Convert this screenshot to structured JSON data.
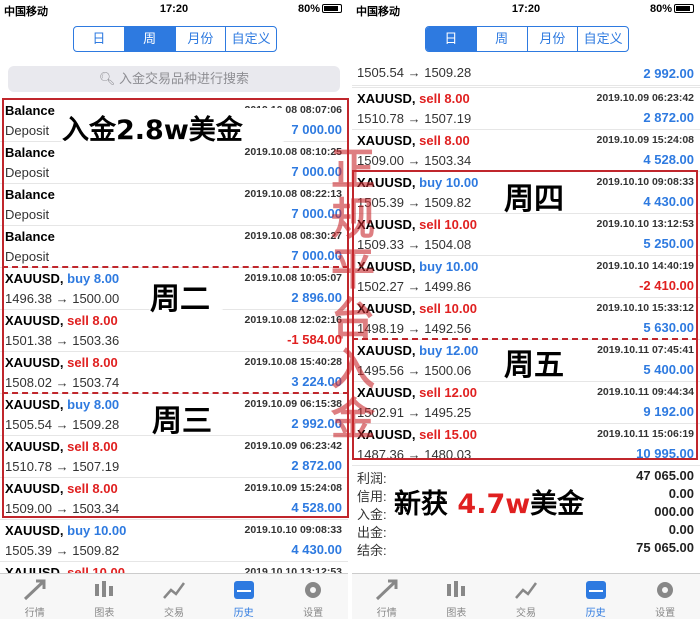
{
  "status": {
    "carrier": "中国移动",
    "time": "17:20",
    "battery": "80%"
  },
  "tabs_periods": [
    "日",
    "周",
    "月份",
    "自定义"
  ],
  "left": {
    "active_period": 1,
    "search_placeholder": "入金交易品种进行搜索",
    "rows": [
      {
        "sym": "Balance",
        "dir": "",
        "sub": "Deposit",
        "ts": "2019.10.08 08:07:06",
        "amt": "7 000.00",
        "color": "blue"
      },
      {
        "sym": "Balance",
        "dir": "",
        "sub": "Deposit",
        "ts": "2019.10.08 08:10:25",
        "amt": "7 000.00",
        "color": "blue"
      },
      {
        "sym": "Balance",
        "dir": "",
        "sub": "Deposit",
        "ts": "2019.10.08 08:22:13",
        "amt": "7 000.00",
        "color": "blue"
      },
      {
        "sym": "Balance",
        "dir": "",
        "sub": "Deposit",
        "ts": "2019.10.08 08:30:27",
        "amt": "7 000.00",
        "color": "blue"
      },
      {
        "sym": "XAUUSD,",
        "dir": "buy 8.00",
        "sub": "1496.38 → 1500.00",
        "ts": "2019.10.08 10:05:07",
        "amt": "2 896.00",
        "color": "blue"
      },
      {
        "sym": "XAUUSD,",
        "dir": "sell 8.00",
        "sub": "1501.38 → 1503.36",
        "ts": "2019.10.08 12:02:16",
        "amt": "-1 584.00",
        "color": "red"
      },
      {
        "sym": "XAUUSD,",
        "dir": "sell 8.00",
        "sub": "1508.02 → 1503.74",
        "ts": "2019.10.08 15:40:28",
        "amt": "3 224.00",
        "color": "blue"
      },
      {
        "sym": "XAUUSD,",
        "dir": "buy 8.00",
        "sub": "1505.54 → 1509.28",
        "ts": "2019.10.09 06:15:38",
        "amt": "2 992.00",
        "color": "blue"
      },
      {
        "sym": "XAUUSD,",
        "dir": "sell 8.00",
        "sub": "1510.78 → 1507.19",
        "ts": "2019.10.09 06:23:42",
        "amt": "2 872.00",
        "color": "blue"
      },
      {
        "sym": "XAUUSD,",
        "dir": "sell 8.00",
        "sub": "1509.00 → 1503.34",
        "ts": "2019.10.09 15:24:08",
        "amt": "4 528.00",
        "color": "blue"
      },
      {
        "sym": "XAUUSD,",
        "dir": "buy 10.00",
        "sub": "1505.39 → 1509.82",
        "ts": "2019.10.10 09:08:33",
        "amt": "4 430.00",
        "color": "blue"
      },
      {
        "sym": "XAUUSD,",
        "dir": "sell 10.00",
        "sub": "",
        "ts": "2019.10.10 13:12:53",
        "amt": "",
        "color": "blue"
      }
    ]
  },
  "right": {
    "active_period": 0,
    "partial": {
      "sub": "1505.54 → 1509.28",
      "amt": "2 992.00"
    },
    "rows": [
      {
        "sym": "XAUUSD,",
        "dir": "sell 8.00",
        "sub": "1510.78 → 1507.19",
        "ts": "2019.10.09 06:23:42",
        "amt": "2 872.00",
        "color": "blue"
      },
      {
        "sym": "XAUUSD,",
        "dir": "sell 8.00",
        "sub": "1509.00 → 1503.34",
        "ts": "2019.10.09 15:24:08",
        "amt": "4 528.00",
        "color": "blue"
      },
      {
        "sym": "XAUUSD,",
        "dir": "buy 10.00",
        "sub": "1505.39 → 1509.82",
        "ts": "2019.10.10 09:08:33",
        "amt": "4 430.00",
        "color": "blue"
      },
      {
        "sym": "XAUUSD,",
        "dir": "sell 10.00",
        "sub": "1509.33 → 1504.08",
        "ts": "2019.10.10 13:12:53",
        "amt": "5 250.00",
        "color": "blue"
      },
      {
        "sym": "XAUUSD,",
        "dir": "buy 10.00",
        "sub": "1502.27 → 1499.86",
        "ts": "2019.10.10 14:40:19",
        "amt": "-2 410.00",
        "color": "red"
      },
      {
        "sym": "XAUUSD,",
        "dir": "sell 10.00",
        "sub": "1498.19 → 1492.56",
        "ts": "2019.10.10 15:33:12",
        "amt": "5 630.00",
        "color": "blue"
      },
      {
        "sym": "XAUUSD,",
        "dir": "buy 12.00",
        "sub": "1495.56 → 1500.06",
        "ts": "2019.10.11 07:45:41",
        "amt": "5 400.00",
        "color": "blue"
      },
      {
        "sym": "XAUUSD,",
        "dir": "sell 12.00",
        "sub": "1502.91 → 1495.25",
        "ts": "2019.10.11 09:44:34",
        "amt": "9 192.00",
        "color": "blue"
      },
      {
        "sym": "XAUUSD,",
        "dir": "sell 15.00",
        "sub": "1487.36 → 1480.03",
        "ts": "2019.10.11 15:06:19",
        "amt": "10 995.00",
        "color": "blue"
      }
    ],
    "summary": [
      {
        "label": "利润:",
        "value": "47 065.00"
      },
      {
        "label": "信用:",
        "value": "0.00"
      },
      {
        "label": "入金:",
        "value": "28 000.00"
      },
      {
        "label": "出金:",
        "value": "0.00"
      },
      {
        "label": "结余:",
        "value": "75 065.00"
      }
    ]
  },
  "bottom_tabs": [
    "行情",
    "图表",
    "交易",
    "历史",
    "设置"
  ],
  "annotations": {
    "deposit": "入金2.8w美金",
    "tue": "周二",
    "wed": "周三",
    "thu": "周四",
    "fri": "周五",
    "profit": "新获",
    "profit_amount": "4.7w",
    "profit_unit": "美金",
    "stamp": "正规平台入金"
  }
}
